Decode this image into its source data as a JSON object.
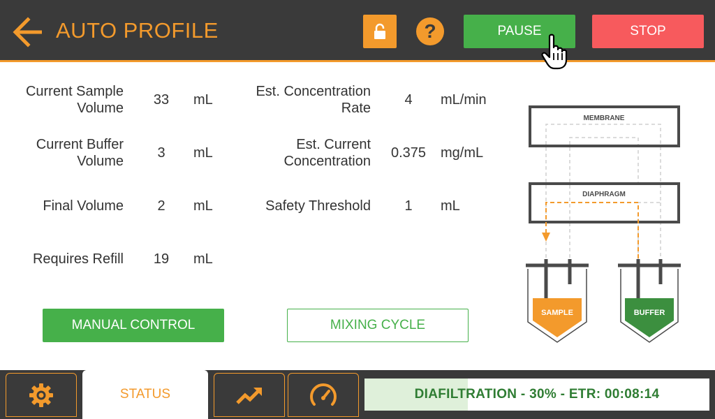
{
  "header": {
    "title": "AUTO PROFILE",
    "help_label": "?",
    "pause_label": "PAUSE",
    "stop_label": "STOP",
    "icons": {
      "back": "arrow-left-icon",
      "lock": "lock-icon",
      "cursor": "hand-pointer-icon"
    }
  },
  "metrics": {
    "current_sample_volume": {
      "label_line1": "Current Sample",
      "label_line2": "Volume",
      "value": "33",
      "unit": "mL"
    },
    "current_buffer_volume": {
      "label_line1": "Current Buffer",
      "label_line2": "Volume",
      "value": "3",
      "unit": "mL"
    },
    "final_volume": {
      "label": "Final Volume",
      "value": "2",
      "unit": "mL"
    },
    "requires_refill": {
      "label": "Requires Refill",
      "value": "19",
      "unit": "mL"
    },
    "est_concentration_rate": {
      "label_line1": "Est. Concentration",
      "label_line2": "Rate",
      "value": "4",
      "unit": "mL/min"
    },
    "est_current_concentration": {
      "label_line1": "Est. Current",
      "label_line2": "Concentration",
      "value": "0.375",
      "unit": "mg/mL"
    },
    "safety_threshold": {
      "label": "Safety Threshold",
      "value": "1",
      "unit": "mL"
    }
  },
  "actions": {
    "manual_control_label": "MANUAL CONTROL",
    "mixing_cycle_label": "MIXING CYCLE"
  },
  "diagram": {
    "membrane_label": "MEMBRANE",
    "diaphragm_label": "DIAPHRAGM",
    "sample_label": "SAMPLE",
    "buffer_label": "BUFFER",
    "colors": {
      "sample": "#f39a2c",
      "buffer": "#3c8f3f",
      "frame": "#4a4a4a"
    }
  },
  "footer": {
    "status_tab_label": "STATUS",
    "progress_text": "DIAFILTRATION - 30% - ETR: 00:08:14",
    "progress_percent": 30,
    "icons": {
      "settings": "gear-icon",
      "trend": "trend-up-icon",
      "gauge": "speedometer-icon"
    }
  },
  "colors": {
    "accent": "#f39a2c",
    "header_bg": "#3a3a3a",
    "pause": "#46b04a",
    "stop": "#f75a5d"
  }
}
